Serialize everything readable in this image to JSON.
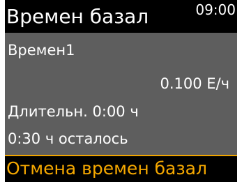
{
  "header": {
    "title": "Времен базал",
    "time": "09:00"
  },
  "temp_basal": {
    "name": "Времен1",
    "rate": "0.100 Е/ч",
    "duration": "Длительн. 0:00 ч",
    "remaining": "0:30 ч осталось"
  },
  "action": {
    "cancel_label": "Отмена времен базал"
  },
  "colors": {
    "background": "#5e5e5e",
    "header": "#000000",
    "accent": "#f5a800",
    "text": "#ffffff"
  }
}
